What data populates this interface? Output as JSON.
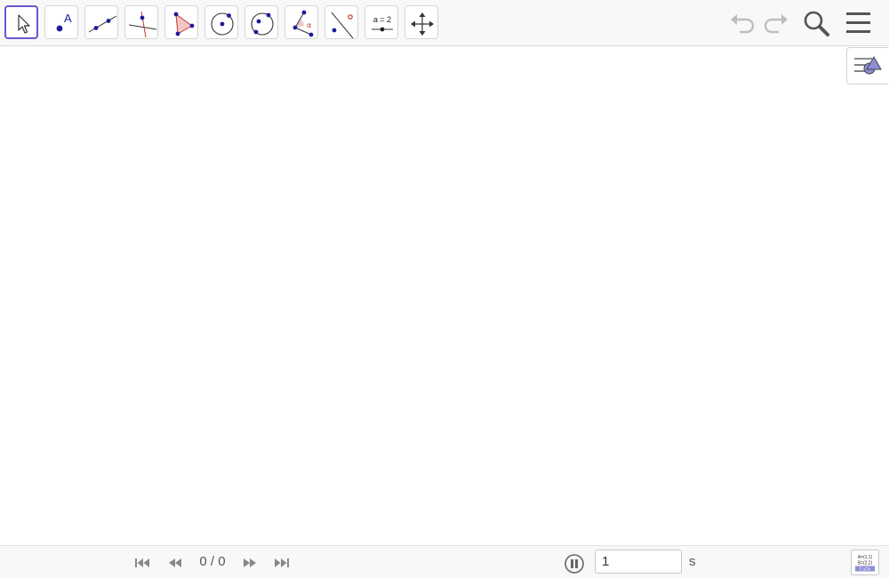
{
  "toolbar": {
    "tools": [
      {
        "id": "move",
        "icon": "move-arrow-icon",
        "selected": true
      },
      {
        "id": "point",
        "icon": "point-icon",
        "label": "A"
      },
      {
        "id": "line",
        "icon": "line-through-two-points-icon"
      },
      {
        "id": "perpendicular",
        "icon": "perpendicular-line-icon"
      },
      {
        "id": "polygon",
        "icon": "polygon-icon"
      },
      {
        "id": "circle",
        "icon": "circle-center-point-icon"
      },
      {
        "id": "circle3",
        "icon": "circle-three-points-icon"
      },
      {
        "id": "angle",
        "icon": "angle-icon",
        "label": "α"
      },
      {
        "id": "reflect",
        "icon": "reflect-about-line-icon"
      },
      {
        "id": "slider",
        "icon": "slider-icon",
        "label": "a = 2"
      },
      {
        "id": "pan",
        "icon": "move-graphics-view-icon"
      }
    ],
    "undo_icon": "undo-icon",
    "redo_icon": "redo-icon",
    "search_icon": "search-icon",
    "menu_icon": "hamburger-menu-icon"
  },
  "style_bar": {
    "icon": "style-bar-toggle-icon"
  },
  "playbar": {
    "step_text": "0 / 0",
    "speed_value": "1",
    "speed_unit": "s",
    "algebra_icon_lines": [
      "A=(1,1)",
      "B=(2,2)",
      "f: y=x"
    ]
  },
  "colors": {
    "accent": "#6557d2",
    "point": "#1b1b9c",
    "toolbar_bg": "#f8f8f8"
  }
}
